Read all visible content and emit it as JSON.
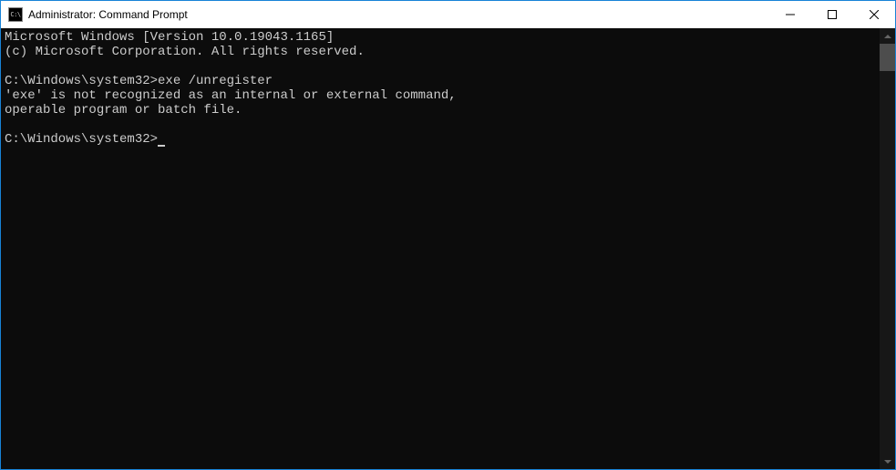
{
  "window": {
    "title": "Administrator: Command Prompt",
    "icon_label": "C:\\"
  },
  "terminal": {
    "lines": [
      "Microsoft Windows [Version 10.0.19043.1165]",
      "(c) Microsoft Corporation. All rights reserved.",
      "",
      "C:\\Windows\\system32>exe /unregister",
      "'exe' is not recognized as an internal or external command,",
      "operable program or batch file.",
      "",
      "C:\\Windows\\system32>"
    ]
  }
}
